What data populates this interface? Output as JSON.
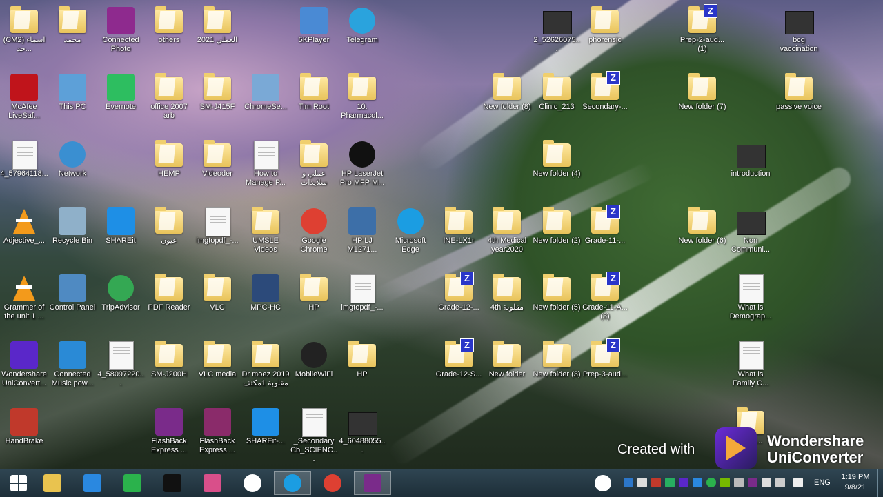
{
  "desktop": {
    "icons": [
      {
        "label": "(CM2) اسماء حد...",
        "kind": "folder"
      },
      {
        "label": "محمد",
        "kind": "folder"
      },
      {
        "label": "Connected Photo",
        "kind": "tile",
        "color": "#8e2a8e"
      },
      {
        "label": "others",
        "kind": "folder"
      },
      {
        "label": "2021 العملي",
        "kind": "folder"
      },
      {
        "label": "5KPlayer",
        "kind": "tile",
        "color": "#4a8ad4"
      },
      {
        "label": "Telegram",
        "kind": "round",
        "color": "#2aa3dd"
      },
      {
        "label": "2_52626075...",
        "kind": "video"
      },
      {
        "label": "phorensic",
        "kind": "folder"
      },
      {
        "label": "Prep-2-aud... (1)",
        "kind": "zfolder"
      },
      {
        "label": "bcg vaccination",
        "kind": "video"
      },
      {
        "label": "McAfee LiveSaf...",
        "kind": "tile",
        "color": "#c0141b"
      },
      {
        "label": "This PC",
        "kind": "tile",
        "color": "#5da0d8"
      },
      {
        "label": "Evernote",
        "kind": "tile",
        "color": "#2dbe60"
      },
      {
        "label": "office 2007 arb",
        "kind": "folder"
      },
      {
        "label": "SM-J415F",
        "kind": "folder"
      },
      {
        "label": "ChromeSe...",
        "kind": "tile",
        "color": "#7aa9d6"
      },
      {
        "label": "Tim Root",
        "kind": "folder"
      },
      {
        "label": "10. Pharmacol...",
        "kind": "folder"
      },
      {
        "label": "New folder (8)",
        "kind": "folder"
      },
      {
        "label": "Clinic_213",
        "kind": "folder"
      },
      {
        "label": "Secondary-...",
        "kind": "zfolder"
      },
      {
        "label": "New folder (7)",
        "kind": "folder"
      },
      {
        "label": "passive voice",
        "kind": "folder"
      },
      {
        "label": "4_57964118...",
        "kind": "doc"
      },
      {
        "label": "Network",
        "kind": "round",
        "color": "#3a8fd1"
      },
      {
        "label": "HEMP",
        "kind": "folder"
      },
      {
        "label": "Videoder",
        "kind": "folder"
      },
      {
        "label": "How to Manage P...",
        "kind": "doc"
      },
      {
        "label": "عملي و سلايدات",
        "kind": "folder"
      },
      {
        "label": "HP LaserJet Pro MFP M...",
        "kind": "round",
        "color": "#111111"
      },
      {
        "label": "New folder (4)",
        "kind": "folder"
      },
      {
        "label": "introduction",
        "kind": "video"
      },
      {
        "label": "Adjective_...",
        "kind": "cone"
      },
      {
        "label": "Recycle Bin",
        "kind": "tile",
        "color": "#8fb0c9"
      },
      {
        "label": "SHAREit",
        "kind": "tile",
        "color": "#1e8fe6"
      },
      {
        "label": "عيون",
        "kind": "folder"
      },
      {
        "label": "imgtopdf_-...",
        "kind": "doc"
      },
      {
        "label": "UMSLE Videos",
        "kind": "folder"
      },
      {
        "label": "Google Chrome",
        "kind": "round",
        "color": "#de4032"
      },
      {
        "label": "HP LJ M1271...",
        "kind": "tile",
        "color": "#3d6fa8"
      },
      {
        "label": "Microsoft Edge",
        "kind": "round",
        "color": "#1b9de2"
      },
      {
        "label": "INE-LX1r",
        "kind": "folder"
      },
      {
        "label": "4th Medical year2020",
        "kind": "folder"
      },
      {
        "label": "New folder (2)",
        "kind": "folder"
      },
      {
        "label": "Grade-11-...",
        "kind": "zfolder"
      },
      {
        "label": "New folder (6)",
        "kind": "folder"
      },
      {
        "label": "Non Communi...",
        "kind": "video"
      },
      {
        "label": "Grammer of the unit 1 ...",
        "kind": "cone"
      },
      {
        "label": "Control Panel",
        "kind": "tile",
        "color": "#4f8ac2"
      },
      {
        "label": "TripAdvisor",
        "kind": "round",
        "color": "#34a853"
      },
      {
        "label": "PDF Reader",
        "kind": "folder"
      },
      {
        "label": "VLC",
        "kind": "folder"
      },
      {
        "label": "MPC-HC",
        "kind": "tile",
        "color": "#2c4a7a"
      },
      {
        "label": "HP",
        "kind": "folder"
      },
      {
        "label": "imgtopdf_-...",
        "kind": "doc"
      },
      {
        "label": "Grade-12-...",
        "kind": "zfolder"
      },
      {
        "label": "4th مقلوبة",
        "kind": "folder"
      },
      {
        "label": "New folder (5)",
        "kind": "folder"
      },
      {
        "label": "Grade-11-A... (3)",
        "kind": "zfolder"
      },
      {
        "label": "What is Demograp...",
        "kind": "doc"
      },
      {
        "label": "Wondershare UniConvert...",
        "kind": "tile",
        "color": "#5a27c9"
      },
      {
        "label": "Connected Music pow...",
        "kind": "tile",
        "color": "#2a8ad6"
      },
      {
        "label": "4_58097220...",
        "kind": "doc"
      },
      {
        "label": "SM-J200H",
        "kind": "folder"
      },
      {
        "label": "VLC media",
        "kind": "folder"
      },
      {
        "label": "Dr moez 2019 مقلوبة 1مكثف",
        "kind": "folder"
      },
      {
        "label": "MobileWiFi",
        "kind": "round",
        "color": "#222222"
      },
      {
        "label": "HP",
        "kind": "folder"
      },
      {
        "label": "Grade-12-S...",
        "kind": "zfolder"
      },
      {
        "label": "New folder",
        "kind": "folder"
      },
      {
        "label": "New folder (3)",
        "kind": "folder"
      },
      {
        "label": "Prep-3-aud...",
        "kind": "zfolder"
      },
      {
        "label": "What is Family C...",
        "kind": "doc"
      },
      {
        "label": "HandBrake",
        "kind": "tile",
        "color": "#c0392b"
      },
      {
        "label": "FlashBack Express ...",
        "kind": "tile",
        "color": "#7a2b8a"
      },
      {
        "label": "FlashBack Express ...",
        "kind": "tile",
        "color": "#8a2b6a"
      },
      {
        "label": "SHAREit-...",
        "kind": "tile",
        "color": "#1e8fe6"
      },
      {
        "label": "_Secondary Cb_SCIENC...",
        "kind": "doc"
      },
      {
        "label": "4_60488055...",
        "kind": "video"
      },
      {
        "label": "his H...",
        "kind": "folder"
      }
    ]
  },
  "watermark": {
    "created": "Created with",
    "brand_line1": "Wondershare",
    "brand_line2": "UniConverter"
  },
  "taskbar": {
    "buttons": [
      {
        "name": "start-button",
        "color": "#ffffff"
      },
      {
        "name": "file-explorer-button",
        "color": "#e9c34f"
      },
      {
        "name": "internet-explorer-button",
        "color": "#2a88e0"
      },
      {
        "name": "store-button",
        "color": "#2bb24c"
      },
      {
        "name": "camera-app-button",
        "color": "#111111"
      },
      {
        "name": "photos-app-button",
        "color": "#d94f8a"
      },
      {
        "name": "hp-app-button",
        "color": "#ffffff"
      },
      {
        "name": "edge-button",
        "color": "#1b9de2"
      },
      {
        "name": "chrome-button",
        "color": "#de4032"
      },
      {
        "name": "flashback-button",
        "color": "#7a2b8a"
      }
    ],
    "language": "ENG",
    "time": "1:19 PM",
    "date": "9/8/21"
  }
}
